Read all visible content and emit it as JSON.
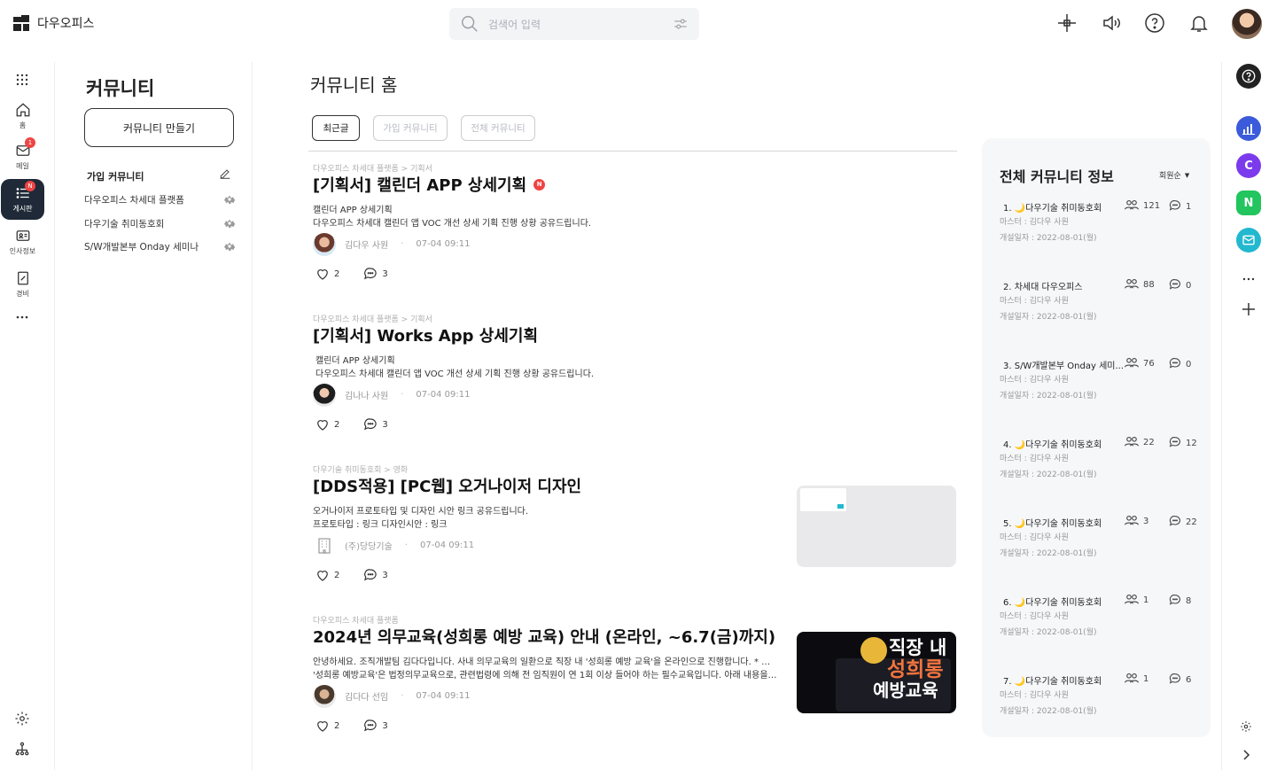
{
  "app": {
    "name": "다우오피스"
  },
  "search": {
    "placeholder": "검색어 입력"
  },
  "rail": {
    "items": [
      {
        "label": "홈"
      },
      {
        "label": "메일",
        "badge": "1"
      },
      {
        "label": "게시판",
        "badge": "N"
      },
      {
        "label": "인사정보"
      },
      {
        "label": "경비"
      }
    ]
  },
  "subnav": {
    "title": "커뮤니티",
    "create_label": "커뮤니티 만들기",
    "joined_heading": "가입 커뮤니티",
    "items": [
      {
        "label": "다우오피스 차세대 플랫폼"
      },
      {
        "label": "다우기술 취미동호회"
      },
      {
        "label": "S/W개발본부 Onday 세미나"
      }
    ]
  },
  "main": {
    "title": "커뮤니티 홈",
    "tabs": [
      {
        "label": "최근글"
      },
      {
        "label": "가입 커뮤니티"
      },
      {
        "label": "전체 커뮤니티"
      }
    ],
    "posts": [
      {
        "category": "다우오피스 차세대 플랫폼 > 기획서",
        "title": "[기획서] 캘린더 APP 상세기획",
        "new_badge": "N",
        "line1": "캘린더 APP 상세기획",
        "line2": "다우오피스 차세대 캘린더 앱 VOC 개선 상세 기획 진행 상황 공유드립니다.",
        "author": "김다우 사원",
        "date": "07-04 09:11",
        "likes": "2",
        "comments": "3"
      },
      {
        "category": "다우오피스 차세대 플랫폼 > 기획서",
        "title": "[기획서] Works App 상세기획",
        "line1": "캘린더 APP 상세기획",
        "line2": "다우오피스 차세대 캘린더 앱 VOC 개선 상세 기획 진행 상황 공유드립니다.",
        "author": "김나나 사원",
        "date": "07-04 09:11",
        "likes": "2",
        "comments": "3"
      },
      {
        "category": "다우기술 취미동호회 > 영화",
        "title": "[DDS적용] [PC웹] 오거나이저 디자인",
        "line1": "오거나이저 프로토타입 및 디자인 시안 링크 공유드립니다.",
        "line2": "프로토타입 : 링크 디자인시안 : 링크",
        "author": "(주)당당기술",
        "date": "07-04 09:11",
        "likes": "2",
        "comments": "3"
      },
      {
        "category": "다우오피스 차세대 플랫폼",
        "title": "2024년 의무교육(성희롱 예방 교육) 안내 (온라인, ~6.7(금)까지)",
        "line1": "안녕하세요. 조직개발팀 김다다입니다. 사내 의무교육의 일환으로 직장 내 '성희롱 예방 교육'을 온라인으로 진행합니다. * 직장 내",
        "line2": "'성희롱 예방교육'은 법정의무교육으로, 관련법령에 의해 전 임직원이 연 1회 이상 들어야 하는 필수교육입니다. 아래 내용을 확…",
        "author": "김다다 선임",
        "date": "07-04 09:11",
        "likes": "2",
        "comments": "3",
        "thumb_text_top": "직장 내",
        "thumb_text_mid": "성희롱",
        "thumb_text_bot": "예방교육"
      }
    ]
  },
  "info": {
    "title": "전체 커뮤니티 정보",
    "sort_label": "회원순",
    "communities": [
      {
        "name": "1. 🌙다우기술 취미동호회",
        "master": "마스터 : 김다우 사원",
        "opened": "개설일자 : 2022-08-01(월)",
        "members": "121",
        "posts": "1"
      },
      {
        "name": "2. 차세대 다우오피스",
        "master": "마스터 : 김다우 사원",
        "opened": "개설일자 : 2022-08-01(월)",
        "members": "88",
        "posts": "0"
      },
      {
        "name": "3. S/W개발본부 Onday 세미...",
        "master": "마스터 : 김다우 사원",
        "opened": "개설일자 : 2022-08-01(월)",
        "members": "76",
        "posts": "0"
      },
      {
        "name": "4. 🌙다우기술 취미동호회",
        "master": "마스터 : 김다우 사원",
        "opened": "개설일자 : 2022-08-01(월)",
        "members": "22",
        "posts": "12"
      },
      {
        "name": "5. 🌙다우기술 취미동호회",
        "master": "마스터 : 김다우 사원",
        "opened": "개설일자 : 2022-08-01(월)",
        "members": "3",
        "posts": "22"
      },
      {
        "name": "6. 🌙다우기술 취미동호회",
        "master": "마스터 : 김다우 사원",
        "opened": "개설일자 : 2022-08-01(월)",
        "members": "1",
        "posts": "8"
      },
      {
        "name": "7. 🌙다우기술 취미동호회",
        "master": "마스터 : 김다우 사원",
        "opened": "개설일자 : 2022-08-01(월)",
        "members": "1",
        "posts": "6"
      }
    ]
  },
  "rrail": {
    "apps": [
      {
        "icon": "chart-app-icon",
        "color": "#3b5bdb"
      },
      {
        "icon": "c-app-icon",
        "letter": "C",
        "color": "#7c3aed"
      },
      {
        "icon": "n-app-icon",
        "letter": "N",
        "color": "#22c55e"
      },
      {
        "icon": "mail-app-icon",
        "color": "#22b8cf"
      }
    ]
  },
  "colors": {
    "accent_dark": "#1f2937",
    "badge_red": "#ef4444"
  }
}
